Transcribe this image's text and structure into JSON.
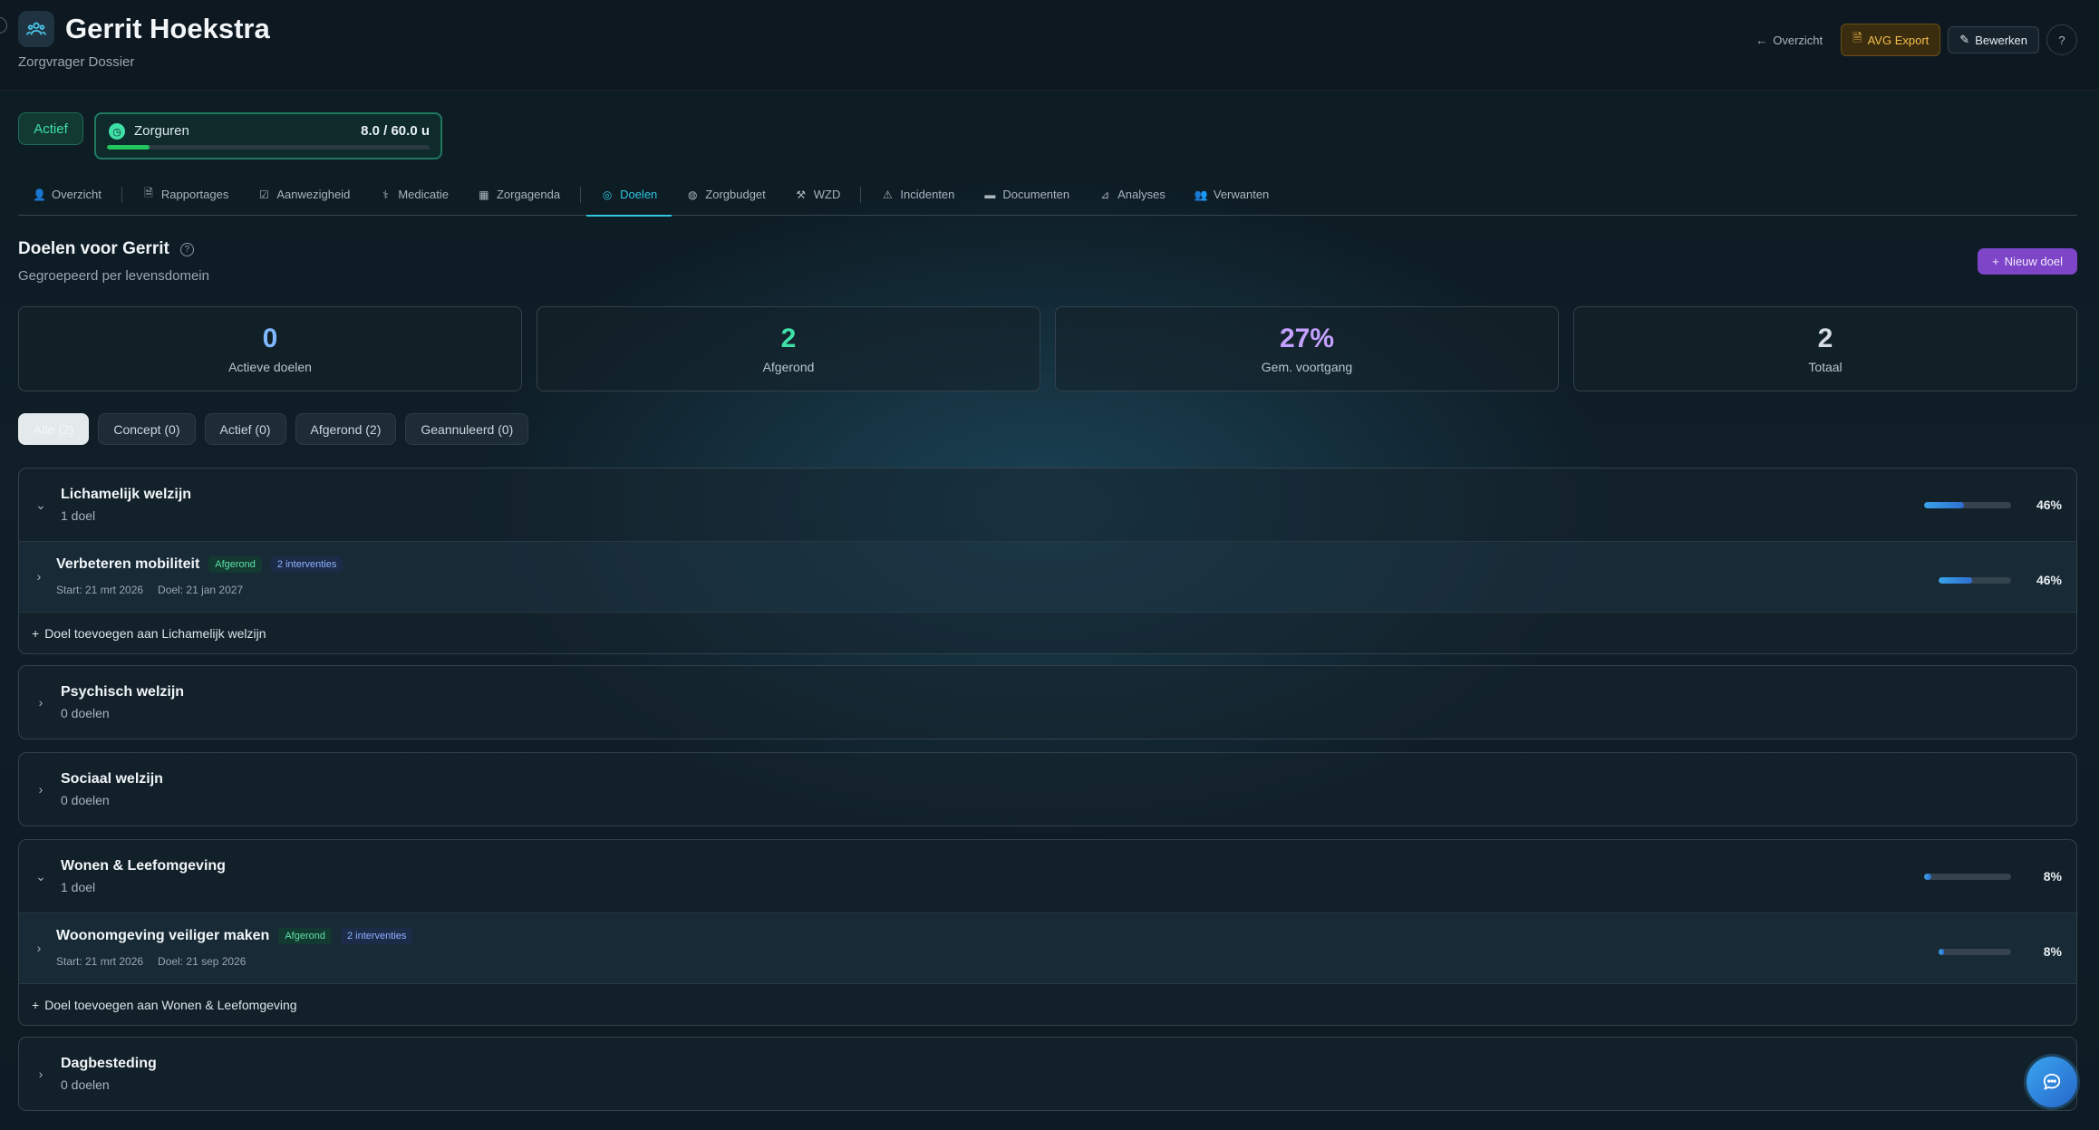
{
  "header": {
    "title": "Gerrit Hoekstra",
    "subtitle": "Zorgvrager Dossier",
    "back_label": "Overzicht",
    "export_label": "AVG Export",
    "edit_label": "Bewerken"
  },
  "status": {
    "badge": "Actief",
    "hours_label": "Zorguren",
    "hours_value": "8.0 / 60.0 u",
    "hours_progress": 0.133
  },
  "tabs": [
    {
      "label": "Overzicht",
      "icon": "user-icon"
    },
    {
      "label": "Rapportages",
      "icon": "document-icon"
    },
    {
      "label": "Aanwezigheid",
      "icon": "check-square-icon"
    },
    {
      "label": "Medicatie",
      "icon": "pills-icon"
    },
    {
      "label": "Zorgagenda",
      "icon": "calendar-icon"
    },
    {
      "label": "Doelen",
      "icon": "target-icon",
      "active": true
    },
    {
      "label": "Zorgbudget",
      "icon": "coin-icon"
    },
    {
      "label": "WZD",
      "icon": "gavel-icon"
    },
    {
      "label": "Incidenten",
      "icon": "warning-icon"
    },
    {
      "label": "Documenten",
      "icon": "folder-icon"
    },
    {
      "label": "Analyses",
      "icon": "chart-icon"
    },
    {
      "label": "Verwanten",
      "icon": "people-icon"
    }
  ],
  "section": {
    "title": "Doelen voor Gerrit",
    "subtitle": "Gegroepeerd per levensdomein",
    "new_button": "Nieuw doel"
  },
  "stats": [
    {
      "value": "0",
      "label": "Actieve doelen",
      "color": "#7fb8ff"
    },
    {
      "value": "2",
      "label": "Afgerond",
      "color": "#3fe0a6"
    },
    {
      "value": "27%",
      "label": "Gem. voortgang",
      "color": "#c4a1ff"
    },
    {
      "value": "2",
      "label": "Totaal",
      "color": "#d5dce1"
    }
  ],
  "filters": [
    {
      "label": "Alle (2)",
      "active": true
    },
    {
      "label": "Concept (0)"
    },
    {
      "label": "Actief (0)"
    },
    {
      "label": "Afgerond (2)"
    },
    {
      "label": "Geannuleerd (0)"
    }
  ],
  "groups": [
    {
      "name": "Lichamelijk welzijn",
      "count": "1 doel",
      "expanded": true,
      "percent": "46%",
      "progress": 0.46,
      "goal": {
        "name": "Verbeteren mobiliteit",
        "status": "Afgerond",
        "interventions": "2 interventies",
        "start": "Start: 21 mrt 2026",
        "target": "Doel: 21 jan 2027",
        "percent": "46%",
        "progress": 0.46
      },
      "add_label": "Doel toevoegen aan Lichamelijk welzijn"
    },
    {
      "name": "Psychisch welzijn",
      "count": "0 doelen",
      "expanded": false
    },
    {
      "name": "Sociaal welzijn",
      "count": "0 doelen",
      "expanded": false
    },
    {
      "name": "Wonen & Leefomgeving",
      "count": "1 doel",
      "expanded": true,
      "percent": "8%",
      "progress": 0.08,
      "goal": {
        "name": "Woonomgeving veiliger maken",
        "status": "Afgerond",
        "interventions": "2 interventies",
        "start": "Start: 21 mrt 2026",
        "target": "Doel: 21 sep 2026",
        "percent": "8%",
        "progress": 0.08
      },
      "add_label": "Doel toevoegen aan Wonen & Leefomgeving"
    },
    {
      "name": "Dagbesteding",
      "count": "0 doelen",
      "expanded": false
    }
  ]
}
